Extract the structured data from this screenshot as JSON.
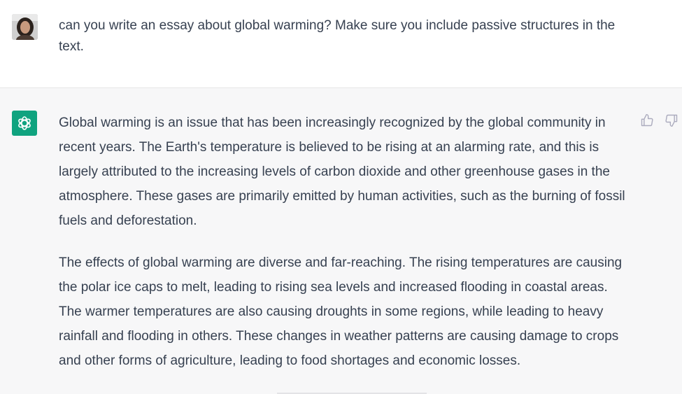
{
  "user_message": {
    "text": "can you write an essay about global warming? Make sure you include passive structures in the text.",
    "avatar_icon": "user-avatar-photo"
  },
  "assistant_message": {
    "avatar_icon": "openai-logo-icon",
    "avatar_color": "#10a37f",
    "paragraphs": [
      "Global warming is an issue that has been increasingly recognized by the global community in recent years. The Earth's temperature is believed to be rising at an alarming rate, and this is largely attributed to the increasing levels of carbon dioxide and other greenhouse gases in the atmosphere. These gases are primarily emitted by human activities, such as the burning of fossil fuels and deforestation.",
      "The effects of global warming are diverse and far-reaching. The rising temperatures are causing the polar ice caps to melt, leading to rising sea levels and increased flooding in coastal areas. The warmer temperatures are also causing droughts in some regions, while leading to heavy rainfall and flooding in others. These changes in weather patterns are causing damage to crops and other forms of agriculture, leading to food shortages and economic losses."
    ],
    "feedback": {
      "thumb_up_icon": "thumbs-up-icon",
      "thumb_down_icon": "thumbs-down-icon"
    }
  },
  "colors": {
    "user_bg": "#ffffff",
    "assistant_bg": "#f7f7f8",
    "text": "#374151",
    "icon": "#acacbe"
  }
}
